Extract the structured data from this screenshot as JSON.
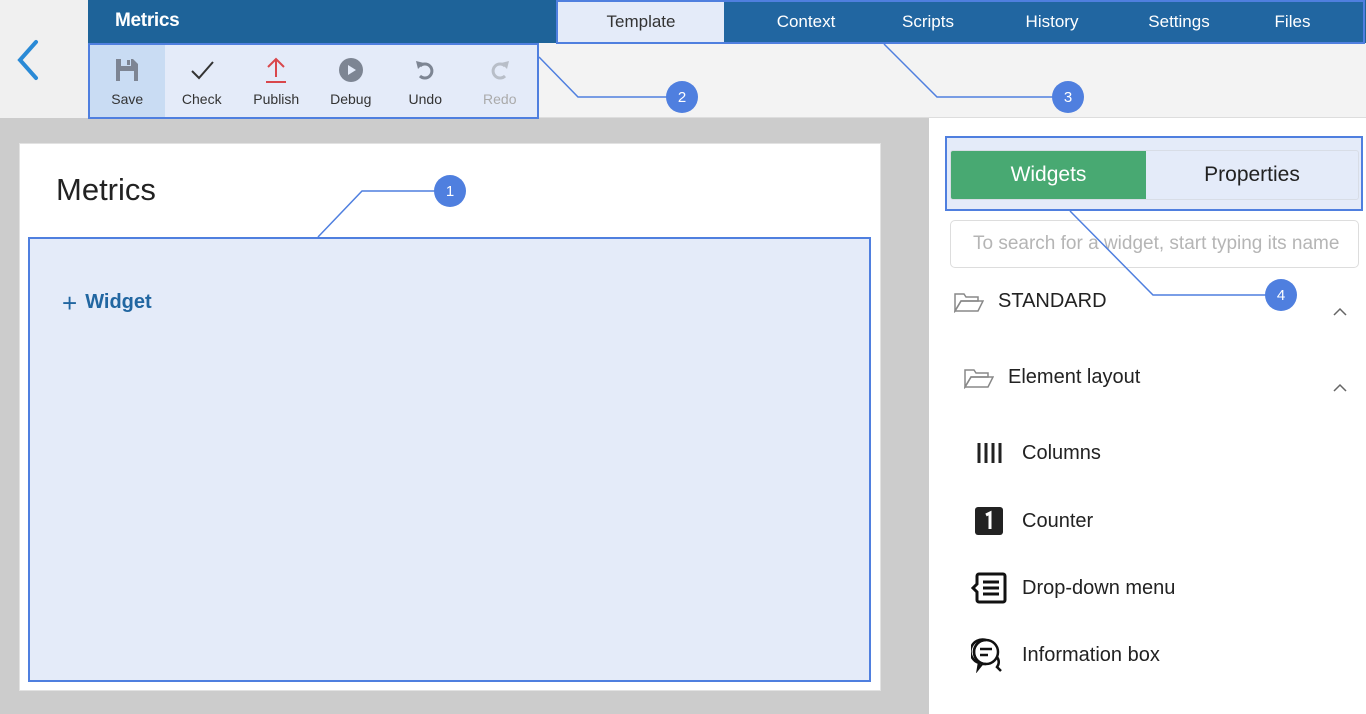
{
  "app": {
    "title": "Metrics",
    "back_icon": "chevron-left-icon"
  },
  "toolbar": {
    "items": [
      {
        "label": "Save",
        "icon": "floppy-disk-icon",
        "state": "active"
      },
      {
        "label": "Check",
        "icon": "checkmark-icon",
        "state": "normal"
      },
      {
        "label": "Publish",
        "icon": "upload-arrow-icon",
        "state": "normal"
      },
      {
        "label": "Debug",
        "icon": "play-circle-icon",
        "state": "normal"
      },
      {
        "label": "Undo",
        "icon": "undo-icon",
        "state": "normal"
      },
      {
        "label": "Redo",
        "icon": "redo-icon",
        "state": "disabled"
      }
    ]
  },
  "tabs": [
    {
      "label": "Template",
      "active": true
    },
    {
      "label": "Context"
    },
    {
      "label": "Scripts"
    },
    {
      "label": "History"
    },
    {
      "label": "Settings"
    },
    {
      "label": "Files"
    }
  ],
  "canvas": {
    "title": "Metrics",
    "add_widget_label": "Widget"
  },
  "sidebar": {
    "tabs": [
      {
        "label": "Widgets",
        "active": true
      },
      {
        "label": "Properties"
      }
    ],
    "search_placeholder": "To search for a widget, start typing its name",
    "groups": [
      {
        "label": "STANDARD",
        "expanded": true
      },
      {
        "label": "Element layout",
        "expanded": true
      }
    ],
    "items": [
      {
        "label": "Columns",
        "icon": "columns-icon"
      },
      {
        "label": "Counter",
        "icon": "counter-icon"
      },
      {
        "label": "Drop-down menu",
        "icon": "dropdown-menu-icon"
      },
      {
        "label": "Information box",
        "icon": "information-box-icon"
      }
    ]
  },
  "callouts": [
    "1",
    "2",
    "3",
    "4"
  ],
  "colors": {
    "header": "#1e6399",
    "tabs": "#2166a1",
    "accent": "#4f7fdf",
    "highlight": "#e4ebf9",
    "widgets_tab": "#48a972",
    "publish_icon": "#d9474c"
  }
}
